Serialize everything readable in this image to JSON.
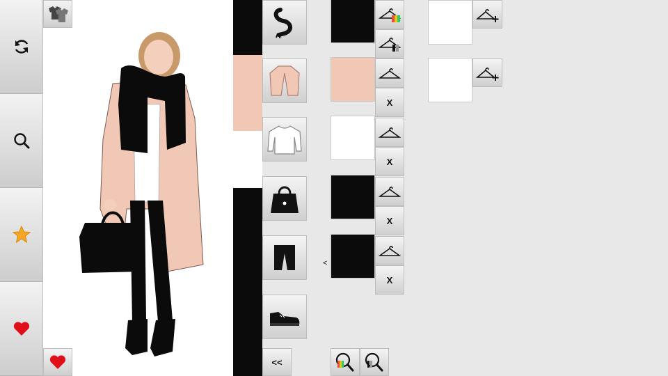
{
  "left_toolbar": {
    "items": [
      {
        "icon": "refresh-icon"
      },
      {
        "icon": "search-icon"
      },
      {
        "icon": "star-icon",
        "color": "#f5a623"
      },
      {
        "icon": "heart-icon",
        "color": "#e0101a"
      }
    ]
  },
  "canvas": {
    "wardrobe_icon": "wardrobe-shirts-icon",
    "favorite_icon": "heart-icon",
    "favorite_color": "#e0101a"
  },
  "color_strip": [
    {
      "color": "#0b0b0b",
      "height_pct": 14.6
    },
    {
      "color": "#f1c8b6",
      "height_pct": 20.2
    },
    {
      "color": "#ffffff",
      "height_pct": 15.2
    },
    {
      "color": "#0b0b0b",
      "height_pct": 50.0
    }
  ],
  "categories": [
    {
      "name": "scarf",
      "swatch": "#0b0b0b",
      "removable": false
    },
    {
      "name": "coat",
      "swatch": "#f1c8b6",
      "removable": true
    },
    {
      "name": "top",
      "swatch": "#ffffff",
      "removable": true
    },
    {
      "name": "bag",
      "swatch": "#0b0b0b",
      "removable": true
    },
    {
      "name": "bottoms",
      "swatch": "#0b0b0b",
      "removable": true
    },
    {
      "name": "shoes",
      "swatch": null,
      "removable": false
    }
  ],
  "labels": {
    "remove": "X",
    "collapse": "<<",
    "prev": "<"
  },
  "colors": {
    "background": "#e8e8e8",
    "canvas": "#ffffff",
    "coat": "#f1c8b6",
    "black": "#0b0b0b"
  }
}
